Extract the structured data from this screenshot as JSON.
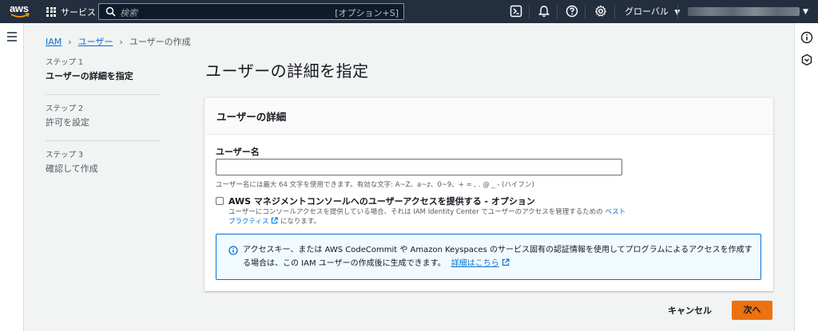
{
  "nav": {
    "logo_text": "aws",
    "services_label": "サービス",
    "search_placeholder": "検索",
    "search_shortcut": "[オプション+S]",
    "region_label": "グローバル"
  },
  "breadcrumb": {
    "items": [
      "IAM",
      "ユーザー"
    ],
    "current": "ユーザーの作成"
  },
  "steps": [
    {
      "number": "ステップ 1",
      "label": "ユーザーの詳細を指定"
    },
    {
      "number": "ステップ 2",
      "label": "許可を設定"
    },
    {
      "number": "ステップ 3",
      "label": "確認して作成"
    }
  ],
  "page_title": "ユーザーの詳細を指定",
  "panel": {
    "header": "ユーザーの詳細",
    "username_label": "ユーザー名",
    "username_value": "",
    "username_hint": "ユーザー名には最大 64 文字を使用できます。有効な文字: A~Z、a~z、0~9、+ = , . @ _ - (ハイフン)",
    "console_access_label": "AWS マネジメントコンソールへのユーザーアクセスを提供する - オプション",
    "console_access_checked": false,
    "console_desc_before": "ユーザーにコンソールアクセスを提供している場合、それは IAM Identity Center でユーザーのアクセスを管理するための",
    "console_desc_link": "ベストプラクティス",
    "console_desc_after": "になります。",
    "info_text": "アクセスキー、または AWS CodeCommit や Amazon Keyspaces のサービス固有の認証情報を使用してプログラムによるアクセスを作成する場合は、この IAM ユーザーの作成後に生成できます。",
    "info_link": "詳細はこちら"
  },
  "footer": {
    "cancel_label": "キャンセル",
    "next_label": "次へ"
  },
  "colors": {
    "nav_bg": "#232f3e",
    "link": "#0972d3",
    "primary_button": "#ec7211",
    "info_bg": "#f1faff"
  }
}
